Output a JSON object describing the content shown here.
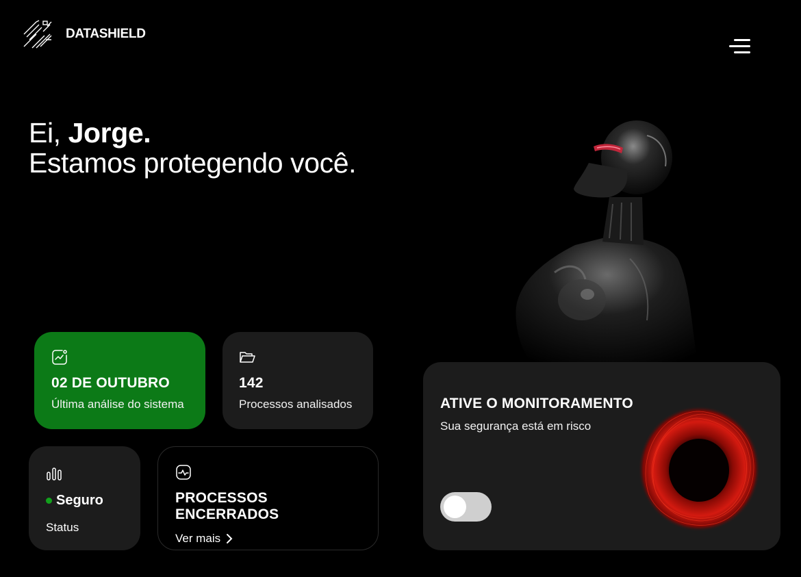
{
  "header": {
    "brand": "DATASHIELD",
    "menu_icon": "menu-icon",
    "logo_icon": "logo-mark"
  },
  "hero": {
    "greeting_prefix": "Ei, ",
    "user_name": "Jorge.",
    "tagline": "Estamos protegendo você."
  },
  "cards": {
    "last_analysis": {
      "icon": "chart-trend-icon",
      "value": "02 DE OUTUBRO",
      "label": "Última análise do sistema"
    },
    "processes": {
      "icon": "folder-open-icon",
      "value": "142",
      "label": "Processos analisados"
    },
    "status": {
      "icon": "bar-chart-icon",
      "value": "Seguro",
      "label": "Status",
      "status_color": "#12a11c"
    },
    "closed": {
      "icon": "pulse-icon",
      "title": "PROCESSOS ENCERRADOS",
      "link": "Ver mais"
    },
    "monitor": {
      "title": "ATIVE O MONITORAMENTO",
      "subtitle": "Sua segurança está em risco",
      "toggle_on": false
    }
  },
  "colors": {
    "background": "#000000",
    "accent_green": "#0c7a17",
    "card": "#1c1c1c",
    "alert_red": "#d41a10"
  }
}
